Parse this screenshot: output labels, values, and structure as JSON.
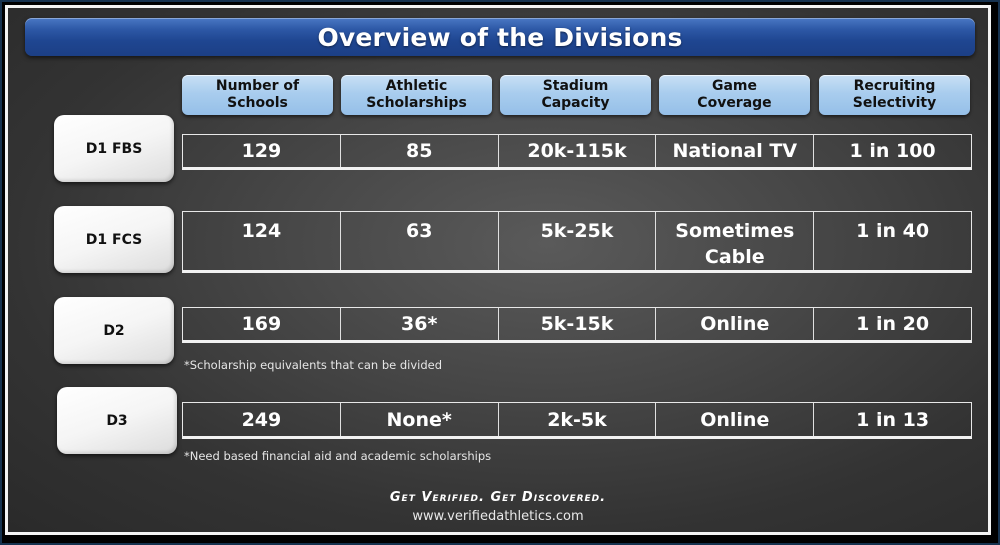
{
  "title": "Overview of the Divisions",
  "columns": [
    "Number of\nSchools",
    "Athletic\nScholarships",
    "Stadium\nCapacity",
    "Game\nCoverage",
    "Recruiting\nSelectivity"
  ],
  "rows": [
    {
      "division": "D1 FBS",
      "values": [
        "129",
        "85",
        "20k-115k",
        "National TV",
        "1 in 100"
      ]
    },
    {
      "division": "D1 FCS",
      "values": [
        "124",
        "63",
        "5k-25k",
        "Sometimes\nCable",
        "1 in 40"
      ]
    },
    {
      "division": "D2",
      "values": [
        "169",
        "36*",
        "5k-15k",
        "Online",
        "1 in 20"
      ]
    },
    {
      "division": "D3",
      "values": [
        "249",
        "None*",
        "2k-5k",
        "Online",
        "1 in 13"
      ]
    }
  ],
  "footnotes": {
    "d2": "*Scholarship equivalents that can be divided",
    "d3": "*Need based financial aid and academic scholarships"
  },
  "footer": {
    "tagline": "Get Verified. Get Discovered.",
    "url": "www.verifiedathletics.com"
  },
  "colors": {
    "title_bar": "#1f4691",
    "column_header": "#a9cdee",
    "row_label": "#f5f5f5",
    "background": "#474747",
    "frame": "#16324f"
  }
}
